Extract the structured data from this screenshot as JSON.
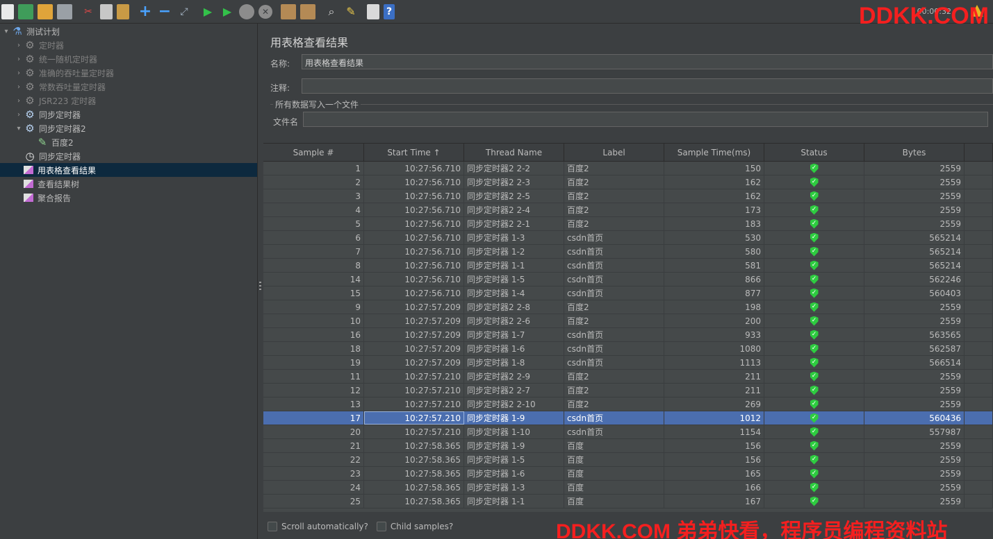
{
  "toolbar": {
    "timer": "00:00:32",
    "icons": [
      "new-icon",
      "templates-icon",
      "open-icon",
      "save-icon",
      "cut-icon",
      "copy-icon",
      "paste-icon",
      "add-icon",
      "remove-icon",
      "expand-icon",
      "start-icon",
      "start-no-pause-icon",
      "stop-icon",
      "shutdown-icon",
      "clear-icon",
      "clear-all-icon",
      "search-icon",
      "reset-search-icon",
      "function-helper-icon",
      "help-icon"
    ]
  },
  "watermark": {
    "top": "DDKK.COM",
    "bottom": "DDKK.COM 弟弟快看，程序员编程资料站"
  },
  "tree": {
    "items": [
      {
        "label": "测试计划",
        "level": 0,
        "chevron": "▾",
        "icon": "flask",
        "state": "normal"
      },
      {
        "label": "定时器",
        "level": 1,
        "chevron": "›",
        "icon": "gear",
        "state": "disabled"
      },
      {
        "label": "统一随机定时器",
        "level": 1,
        "chevron": "›",
        "icon": "gear",
        "state": "disabled"
      },
      {
        "label": "准确的吞吐量定时器",
        "level": 1,
        "chevron": "›",
        "icon": "gear",
        "state": "disabled"
      },
      {
        "label": "常数吞吐量定时器",
        "level": 1,
        "chevron": "›",
        "icon": "gear",
        "state": "disabled"
      },
      {
        "label": "JSR223 定时器",
        "level": 1,
        "chevron": "›",
        "icon": "gear",
        "state": "disabled"
      },
      {
        "label": "同步定时器",
        "level": 1,
        "chevron": "›",
        "icon": "gear-on",
        "state": "normal"
      },
      {
        "label": "同步定时器2",
        "level": 1,
        "chevron": "▾",
        "icon": "gear-on",
        "state": "normal"
      },
      {
        "label": "百度2",
        "level": 2,
        "chevron": "",
        "icon": "pen",
        "state": "normal"
      },
      {
        "label": "同步定时器",
        "level": 1,
        "chevron": "",
        "icon": "clock",
        "state": "normal"
      },
      {
        "label": "用表格查看结果",
        "level": 1,
        "chevron": "",
        "icon": "chart",
        "state": "selected"
      },
      {
        "label": "查看结果树",
        "level": 1,
        "chevron": "",
        "icon": "chart",
        "state": "normal"
      },
      {
        "label": "聚合报告",
        "level": 1,
        "chevron": "",
        "icon": "chart",
        "state": "normal"
      }
    ]
  },
  "panel": {
    "title": "用表格查看结果",
    "name_label": "名称:",
    "name_value": "用表格查看结果",
    "comment_label": "注释:",
    "comment_value": "",
    "fieldset_title": "所有数据写入一个文件",
    "filename_label": "文件名",
    "filename_value": ""
  },
  "table": {
    "columns": [
      "Sample #",
      "Start Time ↑",
      "Thread Name",
      "Label",
      "Sample Time(ms)",
      "Status",
      "Bytes",
      ""
    ],
    "selected_row": 18,
    "rows": [
      [
        "1",
        "10:27:56.710",
        "同步定时器2 2-2",
        "百度2",
        "150",
        "2559"
      ],
      [
        "2",
        "10:27:56.710",
        "同步定时器2 2-3",
        "百度2",
        "162",
        "2559"
      ],
      [
        "3",
        "10:27:56.710",
        "同步定时器2 2-5",
        "百度2",
        "162",
        "2559"
      ],
      [
        "4",
        "10:27:56.710",
        "同步定时器2 2-4",
        "百度2",
        "173",
        "2559"
      ],
      [
        "5",
        "10:27:56.710",
        "同步定时器2 2-1",
        "百度2",
        "183",
        "2559"
      ],
      [
        "6",
        "10:27:56.710",
        "同步定时器 1-3",
        "csdn首页",
        "530",
        "565214"
      ],
      [
        "7",
        "10:27:56.710",
        "同步定时器 1-2",
        "csdn首页",
        "580",
        "565214"
      ],
      [
        "8",
        "10:27:56.710",
        "同步定时器 1-1",
        "csdn首页",
        "581",
        "565214"
      ],
      [
        "14",
        "10:27:56.710",
        "同步定时器 1-5",
        "csdn首页",
        "866",
        "562246"
      ],
      [
        "15",
        "10:27:56.710",
        "同步定时器 1-4",
        "csdn首页",
        "877",
        "560403"
      ],
      [
        "9",
        "10:27:57.209",
        "同步定时器2 2-8",
        "百度2",
        "198",
        "2559"
      ],
      [
        "10",
        "10:27:57.209",
        "同步定时器2 2-6",
        "百度2",
        "200",
        "2559"
      ],
      [
        "16",
        "10:27:57.209",
        "同步定时器 1-7",
        "csdn首页",
        "933",
        "563565"
      ],
      [
        "18",
        "10:27:57.209",
        "同步定时器 1-6",
        "csdn首页",
        "1080",
        "562587"
      ],
      [
        "19",
        "10:27:57.209",
        "同步定时器 1-8",
        "csdn首页",
        "1113",
        "566514"
      ],
      [
        "11",
        "10:27:57.210",
        "同步定时器2 2-9",
        "百度2",
        "211",
        "2559"
      ],
      [
        "12",
        "10:27:57.210",
        "同步定时器2 2-7",
        "百度2",
        "211",
        "2559"
      ],
      [
        "13",
        "10:27:57.210",
        "同步定时器2 2-10",
        "百度2",
        "269",
        "2559"
      ],
      [
        "17",
        "10:27:57.210",
        "同步定时器 1-9",
        "csdn首页",
        "1012",
        "560436"
      ],
      [
        "20",
        "10:27:57.210",
        "同步定时器 1-10",
        "csdn首页",
        "1154",
        "557987"
      ],
      [
        "21",
        "10:27:58.365",
        "同步定时器 1-9",
        "百度",
        "156",
        "2559"
      ],
      [
        "22",
        "10:27:58.365",
        "同步定时器 1-5",
        "百度",
        "156",
        "2559"
      ],
      [
        "23",
        "10:27:58.365",
        "同步定时器 1-6",
        "百度",
        "165",
        "2559"
      ],
      [
        "24",
        "10:27:58.365",
        "同步定时器 1-3",
        "百度",
        "166",
        "2559"
      ],
      [
        "25",
        "10:27:58.365",
        "同步定时器 1-1",
        "百度",
        "167",
        "2559"
      ]
    ]
  },
  "options": {
    "scroll_label": "Scroll automatically?",
    "child_label": "Child samples?"
  }
}
